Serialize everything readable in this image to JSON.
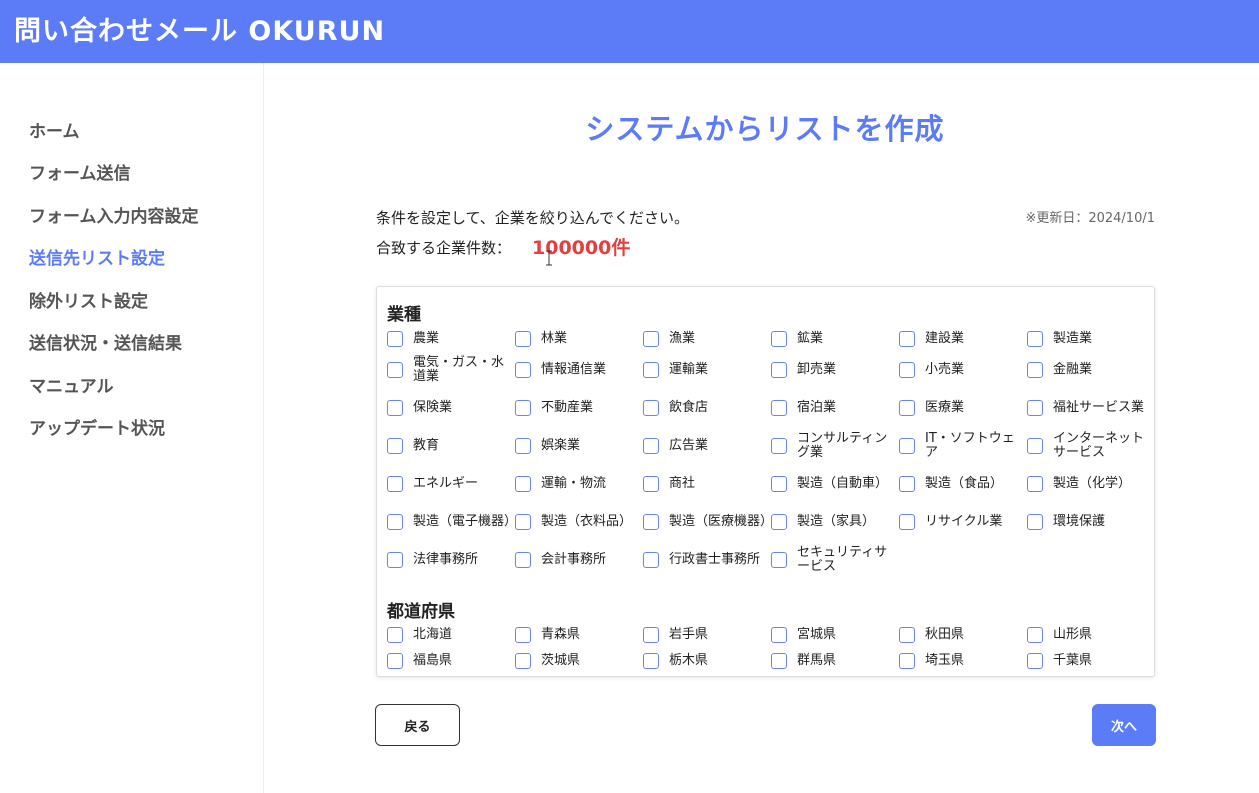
{
  "app": {
    "title": "問い合わせメール OKURUN"
  },
  "sidebar": {
    "items": [
      {
        "label": "ホーム",
        "active": false
      },
      {
        "label": "フォーム送信",
        "active": false
      },
      {
        "label": "フォーム入力内容設定",
        "active": false
      },
      {
        "label": "送信先リスト設定",
        "active": true
      },
      {
        "label": "除外リスト設定",
        "active": false
      },
      {
        "label": "送信状況・送信結果",
        "active": false
      },
      {
        "label": "マニュアル",
        "active": false
      },
      {
        "label": "アップデート状況",
        "active": false
      }
    ]
  },
  "main": {
    "title": "システムからリストを作成",
    "instruction": "条件を設定して、企業を絞り込んでください。",
    "update_date": "※更新日：2024/10/1",
    "count_label": "合致する企業件数：",
    "count_value": "100000件"
  },
  "filters": {
    "industry": {
      "title": "業種",
      "options": [
        {
          "label": "農業",
          "checked": false
        },
        {
          "label": "林業",
          "checked": false
        },
        {
          "label": "漁業",
          "checked": false
        },
        {
          "label": "鉱業",
          "checked": false
        },
        {
          "label": "建設業",
          "checked": false
        },
        {
          "label": "製造業",
          "checked": false
        },
        {
          "label": "電気・ガス・水道業",
          "checked": false
        },
        {
          "label": "情報通信業",
          "checked": false
        },
        {
          "label": "運輸業",
          "checked": false
        },
        {
          "label": "卸売業",
          "checked": false
        },
        {
          "label": "小売業",
          "checked": false
        },
        {
          "label": "金融業",
          "checked": false
        },
        {
          "label": "保険業",
          "checked": false
        },
        {
          "label": "不動産業",
          "checked": false
        },
        {
          "label": "飲食店",
          "checked": false
        },
        {
          "label": "宿泊業",
          "checked": false
        },
        {
          "label": "医療業",
          "checked": false
        },
        {
          "label": "福祉サービス業",
          "checked": false
        },
        {
          "label": "教育",
          "checked": false
        },
        {
          "label": "娯楽業",
          "checked": false
        },
        {
          "label": "広告業",
          "checked": false
        },
        {
          "label": "コンサルティング業",
          "checked": false
        },
        {
          "label": "IT・ソフトウェア",
          "checked": false
        },
        {
          "label": "インターネットサービス",
          "checked": false
        },
        {
          "label": "エネルギー",
          "checked": false
        },
        {
          "label": "運輸・物流",
          "checked": false
        },
        {
          "label": "商社",
          "checked": false
        },
        {
          "label": "製造（自動車）",
          "checked": false
        },
        {
          "label": "製造（食品）",
          "checked": false
        },
        {
          "label": "製造（化学）",
          "checked": false
        },
        {
          "label": "製造（電子機器）",
          "checked": false
        },
        {
          "label": "製造（衣料品）",
          "checked": false
        },
        {
          "label": "製造（医療機器）",
          "checked": false
        },
        {
          "label": "製造（家具）",
          "checked": false
        },
        {
          "label": "リサイクル業",
          "checked": false
        },
        {
          "label": "環境保護",
          "checked": false
        },
        {
          "label": "法律事務所",
          "checked": false
        },
        {
          "label": "会計事務所",
          "checked": false
        },
        {
          "label": "行政書士事務所",
          "checked": false
        },
        {
          "label": "セキュリティサービス",
          "checked": false
        }
      ]
    },
    "prefecture": {
      "title": "都道府県",
      "options": [
        {
          "label": "北海道",
          "checked": false
        },
        {
          "label": "青森県",
          "checked": false
        },
        {
          "label": "岩手県",
          "checked": false
        },
        {
          "label": "宮城県",
          "checked": false
        },
        {
          "label": "秋田県",
          "checked": false
        },
        {
          "label": "山形県",
          "checked": false
        },
        {
          "label": "福島県",
          "checked": false
        },
        {
          "label": "茨城県",
          "checked": false
        },
        {
          "label": "栃木県",
          "checked": false
        },
        {
          "label": "群馬県",
          "checked": false
        },
        {
          "label": "埼玉県",
          "checked": false
        },
        {
          "label": "千葉県",
          "checked": false
        }
      ]
    }
  },
  "buttons": {
    "back": "戻る",
    "next": "次へ"
  },
  "colors": {
    "header_bg": "#5b7cf6",
    "accent": "#5b7cf6",
    "count_red": "#e53e3e",
    "checkbox_border": "#6b87e6"
  },
  "icons": {
    "text_cursor": "i-beam-cursor-icon"
  }
}
